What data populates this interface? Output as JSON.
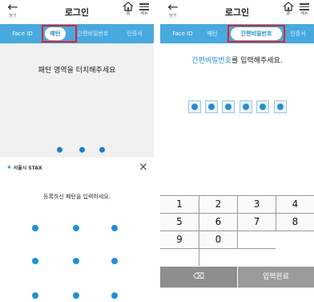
{
  "header": {
    "back_label": "닫기",
    "title": "로그인",
    "home_label": "홈",
    "menu_label": "메뉴"
  },
  "tabs": [
    "Face ID",
    "패턴",
    "간편비밀번호",
    "인증서"
  ],
  "left_top": {
    "selected_tab": "패턴",
    "message": "패턴 영역을 터치해주세요",
    "page_dots": 3
  },
  "right_top": {
    "selected_tab": "간편비밀번호",
    "message_highlight": "간편비밀번호",
    "message_rest": "를 입력해주세요.",
    "pin_filled": 6
  },
  "left_bottom": {
    "logo_text": "서울시 STAX",
    "message": "등록하신 패턴을 입력하세요.",
    "grid_rows": 3,
    "grid_cols": 3
  },
  "keypad": {
    "rows": [
      [
        "1",
        "2",
        "3",
        "4"
      ],
      [
        "5",
        "6",
        "7",
        "8"
      ],
      [
        "9",
        "0",
        "",
        ""
      ]
    ],
    "backspace_label": "⌫",
    "done_label": "입력완료"
  },
  "colors": {
    "tab_bar": "#48a9de",
    "accent": "#2a8ccb",
    "highlight_box": "#e3222a",
    "keypad_bottom": "#8e8e8e"
  }
}
